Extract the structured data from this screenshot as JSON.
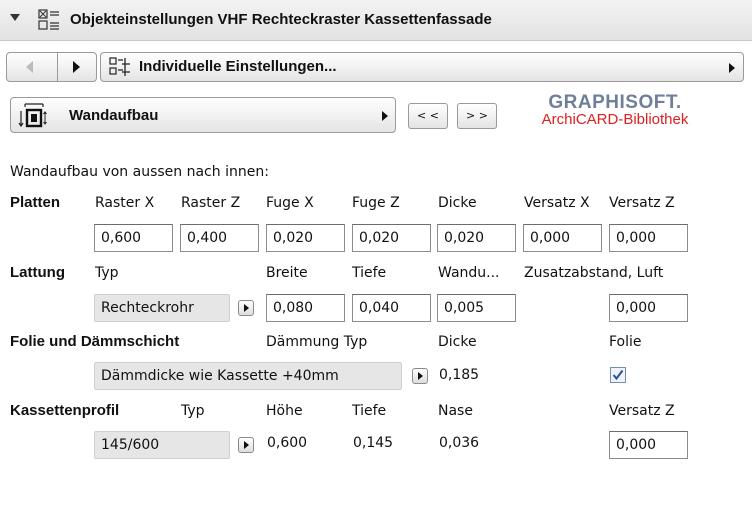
{
  "header": {
    "title": "Objekteinstellungen VHF Rechteckraster Kassettenfassade"
  },
  "nav": {
    "settings_label": "Individuelle Einstellungen..."
  },
  "panel": {
    "selector_label": "Wandaufbau",
    "prev_label": "< <",
    "next_label": "> >",
    "brand_name": "GRAPHISOFT.",
    "brand_sub": "ArchiCARD-Bibliothek"
  },
  "section": {
    "title": "Wandaufbau von aussen nach innen:"
  },
  "platten": {
    "label": "Platten",
    "headers": [
      "Raster X",
      "Raster Z",
      "Fuge X",
      "Fuge Z",
      "Dicke",
      "Versatz X",
      "Versatz Z"
    ],
    "values": [
      "0,600",
      "0,400",
      "0,020",
      "0,020",
      "0,020",
      "0,000",
      "0,000"
    ]
  },
  "lattung": {
    "label": "Lattung",
    "typ_header": "Typ",
    "headers": [
      "Breite",
      "Tiefe",
      "Wandu...",
      "Zusatzabstand, Luft"
    ],
    "typ_value": "Rechteckrohr",
    "values": [
      "0,080",
      "0,040",
      "0,005",
      "0,000"
    ]
  },
  "folie": {
    "label": "Folie und Dämmschicht",
    "daemmung_header": "Dämmung Typ",
    "dicke_header": "Dicke",
    "folie_header": "Folie",
    "daemmung_value": "Dämmdicke wie Kassette +40mm",
    "dicke_value": "0,185",
    "folie_checked": true
  },
  "kassette": {
    "label": "Kassettenprofil",
    "typ_header": "Typ",
    "headers": [
      "Höhe",
      "Tiefe",
      "Nase",
      "Versatz Z"
    ],
    "typ_value": "145/600",
    "hoehe_value": "0,600",
    "tiefe_value": "0,145",
    "nase_value": "0,036",
    "versatz_value": "0,000"
  }
}
